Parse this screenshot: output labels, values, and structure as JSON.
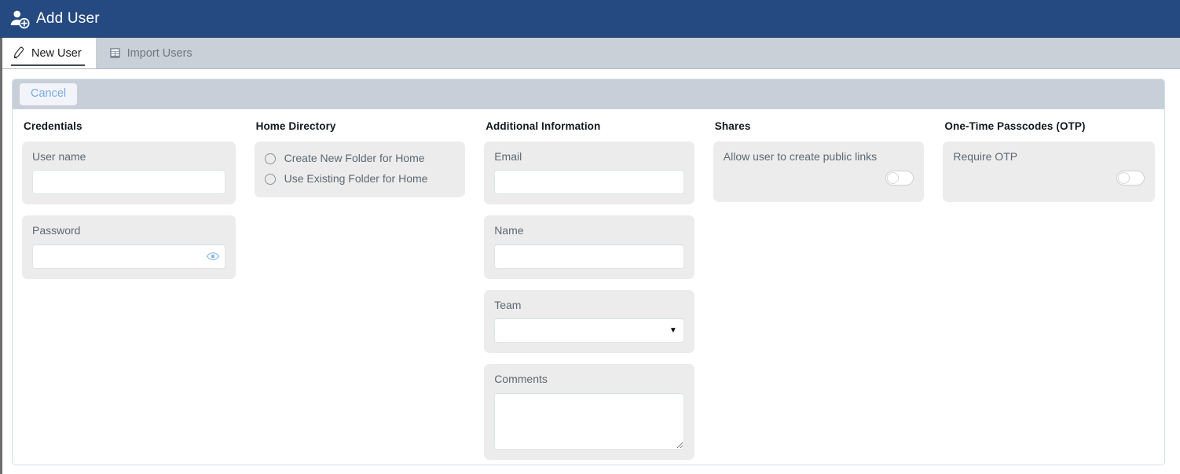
{
  "header": {
    "title": "Add User",
    "icon": "add-user-icon",
    "bg_color": "#254a82",
    "text_color": "#ffffff"
  },
  "tabs": [
    {
      "label": "New User",
      "icon": "pencil-icon",
      "active": true
    },
    {
      "label": "Import Users",
      "icon": "spreadsheet-icon",
      "active": false
    }
  ],
  "toolbar": {
    "cancel_label": "Cancel",
    "bg_color": "#c8cfd8",
    "button_text_color": "#77aae6"
  },
  "columns": {
    "credentials": {
      "title": "Credentials",
      "username": {
        "label": "User name",
        "value": "",
        "placeholder": ""
      },
      "password": {
        "label": "Password",
        "value": "",
        "placeholder": "",
        "reveal_icon": "eye-icon"
      }
    },
    "home_directory": {
      "title": "Home Directory",
      "options": [
        {
          "label": "Create New Folder for Home",
          "selected": false
        },
        {
          "label": "Use Existing Folder for Home",
          "selected": false
        }
      ]
    },
    "additional_information": {
      "title": "Additional Information",
      "email": {
        "label": "Email",
        "value": "",
        "placeholder": ""
      },
      "name": {
        "label": "Name",
        "value": "",
        "placeholder": ""
      },
      "team": {
        "label": "Team",
        "value": "",
        "options": [
          ""
        ],
        "caret_icon": "chevron-down-icon"
      },
      "comments": {
        "label": "Comments",
        "value": "",
        "placeholder": ""
      }
    },
    "shares": {
      "title": "Shares",
      "public_links": {
        "label": "Allow user to create public links",
        "enabled": false
      }
    },
    "otp": {
      "title": "One-Time Passcodes (OTP)",
      "require_otp": {
        "label": "Require OTP",
        "enabled": false
      }
    }
  }
}
